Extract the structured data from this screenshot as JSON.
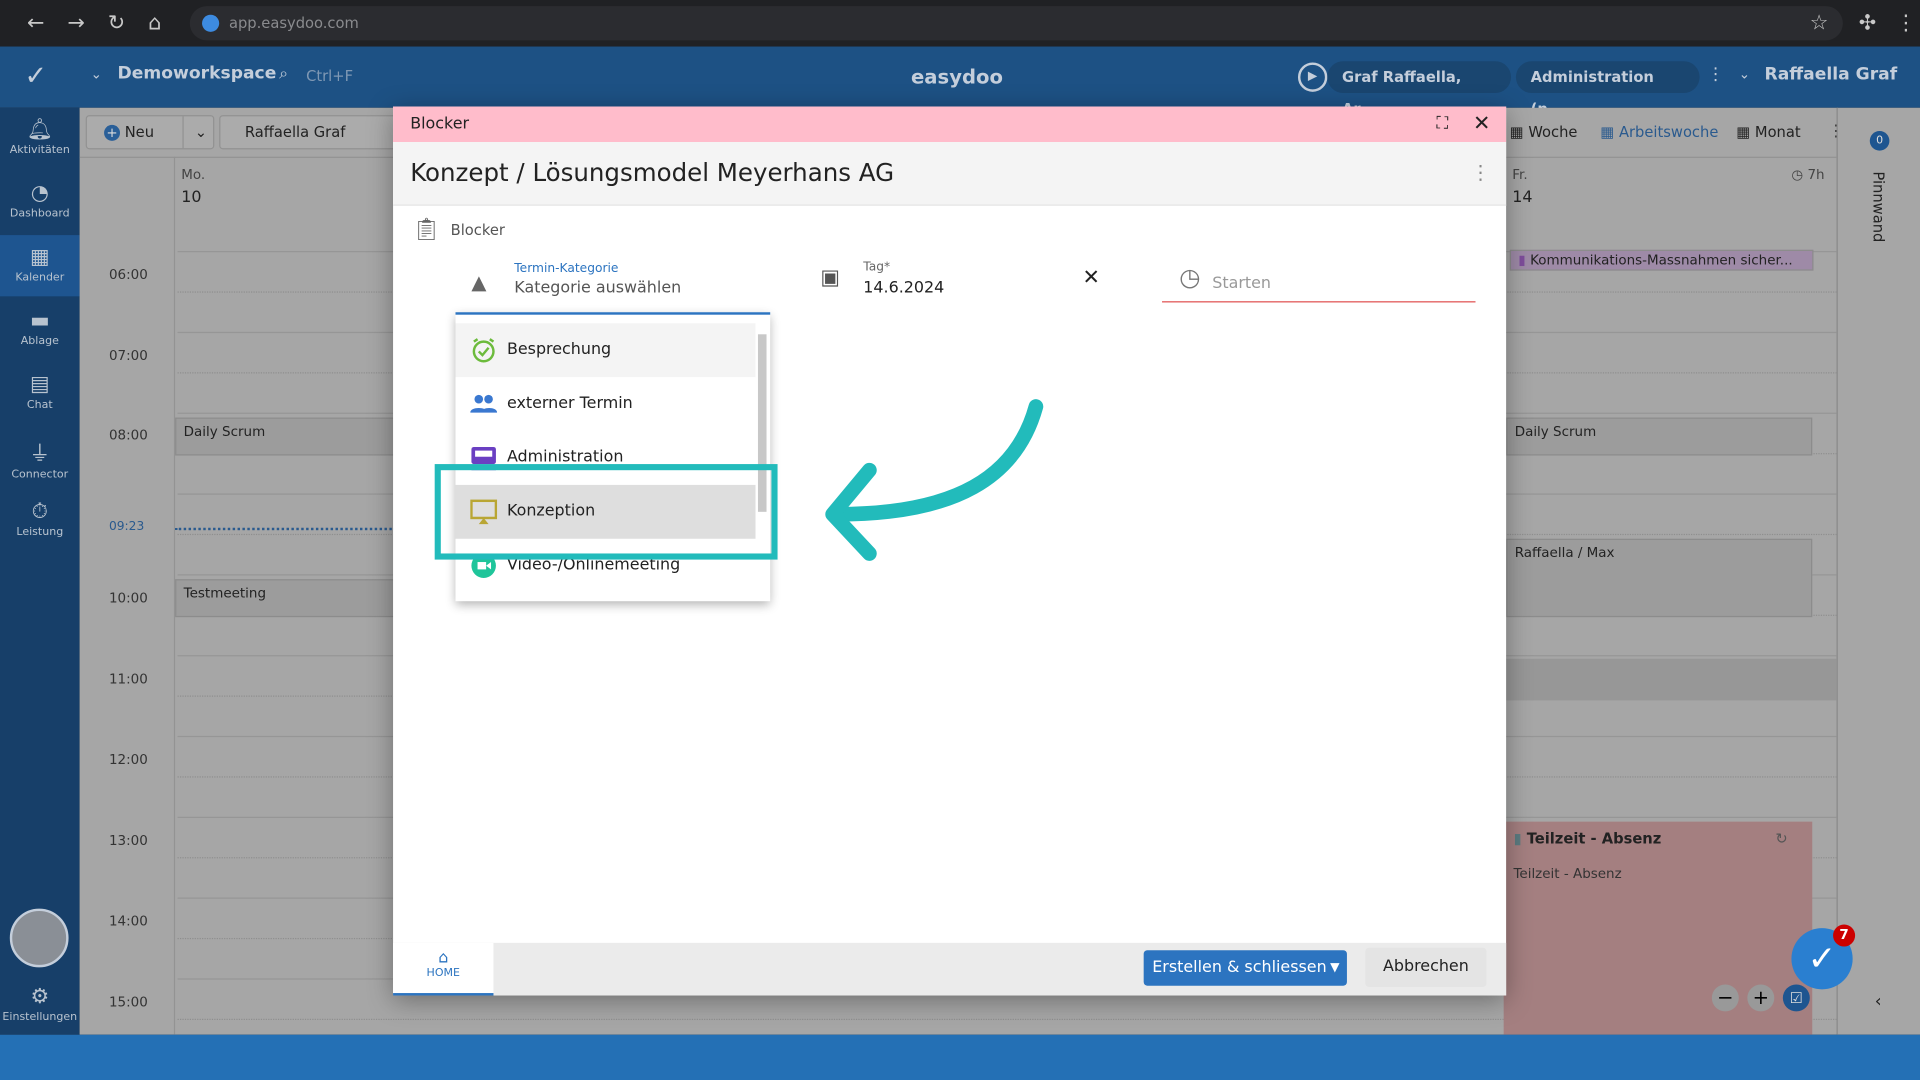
{
  "browser": {
    "url": "app.easydoo.com"
  },
  "header": {
    "workspace": "Demoworkspace",
    "search_hint": "Ctrl+F",
    "app_title": "easydoo",
    "timer_chip": "Graf Raffaella, Ar...",
    "project_chip": "Administration (n...",
    "user": "Raffaella Graf"
  },
  "sidebar": {
    "items": [
      {
        "label": "Aktivitäten",
        "icon": "bell-icon"
      },
      {
        "label": "Dashboard",
        "icon": "gauge-icon"
      },
      {
        "label": "Kalender",
        "icon": "calendar-icon"
      },
      {
        "label": "Ablage",
        "icon": "folder-icon"
      },
      {
        "label": "Chat",
        "icon": "chat-icon"
      },
      {
        "label": "Connector",
        "icon": "plug-icon"
      },
      {
        "label": "Leistung",
        "icon": "stopwatch-icon"
      }
    ],
    "settings": "Einstellungen"
  },
  "toolbar": {
    "new_label": "Neu",
    "person": "Raffaella Graf",
    "views": [
      "Woche",
      "Arbeitswoche",
      "Monat"
    ]
  },
  "calendar": {
    "days": [
      {
        "name": "Mo.",
        "num": "10"
      },
      {
        "name": "Fr.",
        "num": "14",
        "hours": "7h"
      }
    ],
    "times": [
      "06:00",
      "07:00",
      "08:00",
      "09:23",
      "10:00",
      "11:00",
      "12:00",
      "13:00",
      "14:00",
      "15:00"
    ],
    "events_left": [
      "Daily Scrum",
      "Testmeeting"
    ],
    "events_right": {
      "top": "Kommunikations-Massnahmen sicher...",
      "scrum": "Daily Scrum",
      "meeting": "Raffaella / Max",
      "absence_title": "Teilzeit - Absenz",
      "absence_sub": "Teilzeit - Absenz"
    }
  },
  "pinnwand": {
    "label": "Pinnwand",
    "badge": "0"
  },
  "fab": {
    "badge": "7"
  },
  "modal": {
    "type": "Blocker",
    "title": "Konzept / Lösungsmodel Meyerhans AG",
    "section": "Blocker",
    "category": {
      "label": "Termin-Kategorie",
      "placeholder": "Kategorie auswählen"
    },
    "date": {
      "label": "Tag*",
      "value": "14.6.2024"
    },
    "start": {
      "placeholder": "Starten"
    },
    "options": [
      {
        "label": "Besprechung",
        "color": "#6cbb3c"
      },
      {
        "label": "externer Termin",
        "color": "#3a78d0"
      },
      {
        "label": "Administration",
        "color": "#6a3fc2"
      },
      {
        "label": "Konzeption",
        "color": "#b9a634"
      },
      {
        "label": "Video-/Onlinemeeting",
        "color": "#1fc59a"
      }
    ],
    "footer": {
      "home_tab": "HOME",
      "create": "Erstellen & schliessen",
      "cancel": "Abbrechen"
    }
  },
  "annotation": {
    "color": "#22bbbb"
  }
}
